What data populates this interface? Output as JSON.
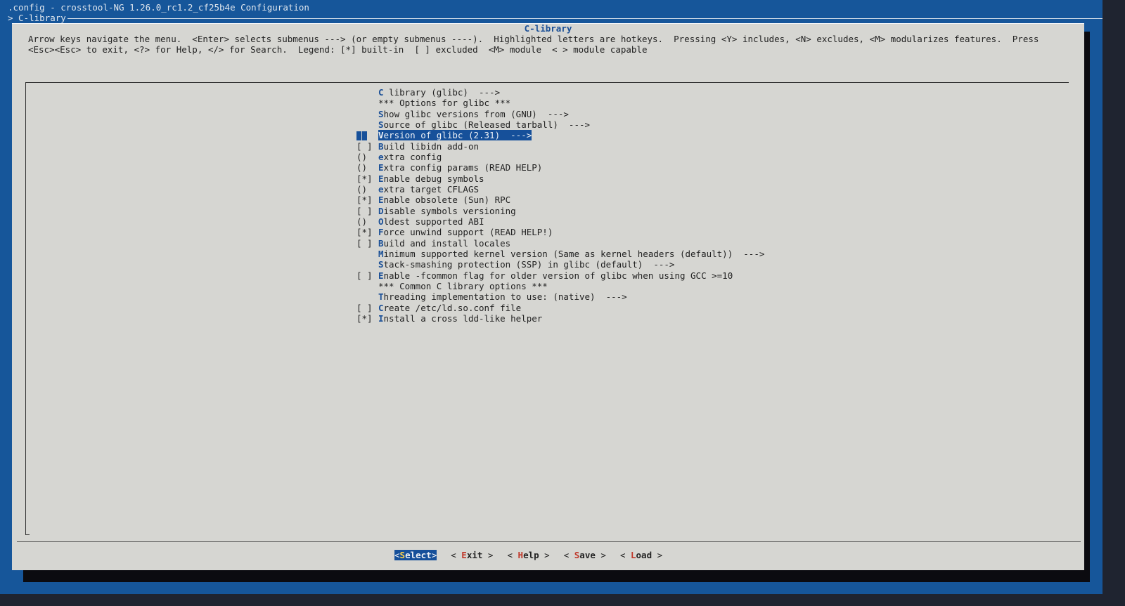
{
  "window": {
    "title": ".config - crosstool-NG 1.26.0_rc1.2_cf25b4e Configuration",
    "breadcrumb": "> C-library"
  },
  "dialog": {
    "title": "C-library",
    "help_line1": "Arrow keys navigate the menu.  <Enter> selects submenus ---> (or empty submenus ----).  Highlighted letters are hotkeys.  Pressing <Y> includes, <N> excludes, <M> modularizes features.  Press",
    "help_line2": "<Esc><Esc> to exit, <?> for Help, </> for Search.  Legend: [*] built-in  [ ] excluded  <M> module  < > module capable"
  },
  "menu": {
    "items": [
      {
        "prefix": "",
        "hotkey": "C",
        "rest": " library (glibc)  --->",
        "selected": false
      },
      {
        "prefix": "",
        "hotkey": "",
        "rest": "*** Options for glibc ***",
        "selected": false
      },
      {
        "prefix": "",
        "hotkey": "S",
        "rest": "how glibc versions from (GNU)  --->",
        "selected": false
      },
      {
        "prefix": "",
        "hotkey": "S",
        "rest": "ource of glibc (Released tarball)  --->",
        "selected": false
      },
      {
        "prefix": "",
        "hotkey": "V",
        "rest": "ersion of glibc (2.31)  --->",
        "selected": true
      },
      {
        "prefix": "[ ]",
        "hotkey": "B",
        "rest": "uild libidn add-on",
        "selected": false
      },
      {
        "prefix": "()",
        "hotkey": "e",
        "rest": "xtra config",
        "selected": false
      },
      {
        "prefix": "()",
        "hotkey": "E",
        "rest": "xtra config params (READ HELP)",
        "selected": false
      },
      {
        "prefix": "[*]",
        "hotkey": "E",
        "rest": "nable debug symbols",
        "selected": false
      },
      {
        "prefix": "()",
        "hotkey": "e",
        "rest": "xtra target CFLAGS",
        "selected": false
      },
      {
        "prefix": "[*]",
        "hotkey": "E",
        "rest": "nable obsolete (Sun) RPC",
        "selected": false
      },
      {
        "prefix": "[ ]",
        "hotkey": "D",
        "rest": "isable symbols versioning",
        "selected": false
      },
      {
        "prefix": "()",
        "hotkey": "O",
        "rest": "ldest supported ABI",
        "selected": false
      },
      {
        "prefix": "[*]",
        "hotkey": "F",
        "rest": "orce unwind support (READ HELP!)",
        "selected": false
      },
      {
        "prefix": "[ ]",
        "hotkey": "B",
        "rest": "uild and install locales",
        "selected": false
      },
      {
        "prefix": "",
        "hotkey": "M",
        "rest": "inimum supported kernel version (Same as kernel headers (default))  --->",
        "selected": false
      },
      {
        "prefix": "",
        "hotkey": "S",
        "rest": "tack-smashing protection (SSP) in glibc (default)  --->",
        "selected": false
      },
      {
        "prefix": "[ ]",
        "hotkey": "E",
        "rest": "nable -fcommon flag for older version of glibc when using GCC >=10",
        "selected": false
      },
      {
        "prefix": "",
        "hotkey": "",
        "rest": "*** Common C library options ***",
        "selected": false
      },
      {
        "prefix": "",
        "hotkey": "T",
        "rest": "hreading implementation to use: (native)  --->",
        "selected": false
      },
      {
        "prefix": "[ ]",
        "hotkey": "C",
        "rest": "reate /etc/ld.so.conf file",
        "selected": false
      },
      {
        "prefix": "[*]",
        "hotkey": "I",
        "rest": "nstall a cross ldd-like helper",
        "selected": false
      }
    ]
  },
  "buttons": [
    {
      "left": "<",
      "hotkey": "S",
      "rest": "elect",
      "right": ">",
      "active": true
    },
    {
      "left": "< ",
      "hotkey": "E",
      "rest": "xit",
      "right": " >",
      "active": false
    },
    {
      "left": "< ",
      "hotkey": "H",
      "rest": "elp",
      "right": " >",
      "active": false
    },
    {
      "left": "< ",
      "hotkey": "S",
      "rest": "ave",
      "right": " >",
      "active": false
    },
    {
      "left": "< ",
      "hotkey": "L",
      "rest": "oad",
      "right": " >",
      "active": false
    }
  ],
  "colors": {
    "background": "#16569a",
    "dialog": "#d6d6d2",
    "hotkey": "#1a4f96",
    "selection": "#16509a",
    "button_hotkey": "#c0392b"
  }
}
